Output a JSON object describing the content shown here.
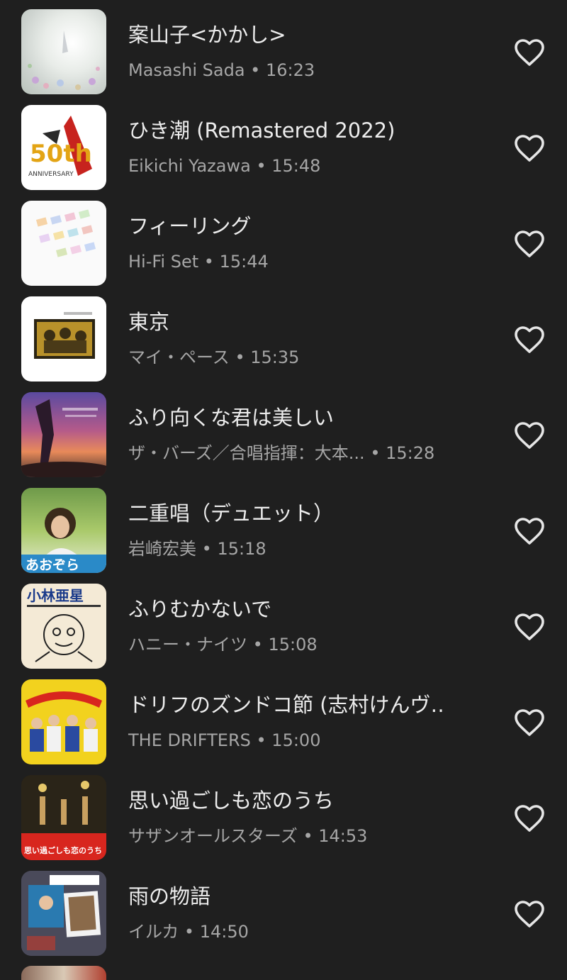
{
  "tracks": [
    {
      "title": "案山子<かかし>",
      "artist": "Masashi Sada",
      "duration": "16:23",
      "art_icon": "album-art-flowers",
      "art_text": ""
    },
    {
      "title": "ひき潮 (Remastered 2022)",
      "artist": "Eikichi Yazawa",
      "duration": "15:48",
      "art_icon": "album-art-50th-anniversary",
      "art_text": "50th"
    },
    {
      "title": "フィーリング",
      "artist": "Hi-Fi Set",
      "duration": "15:44",
      "art_icon": "album-art-pastel",
      "art_text": ""
    },
    {
      "title": "東京",
      "artist": "マイ・ペース",
      "duration": "15:35",
      "art_icon": "album-art-band-photo",
      "art_text": ""
    },
    {
      "title": "ふり向くな君は美しい",
      "artist": "ザ・バーズ／合唱指揮：大本...",
      "duration": "15:28",
      "art_icon": "album-art-sunset",
      "art_text": ""
    },
    {
      "title": "二重唱（デュエット）",
      "artist": "岩崎宏美",
      "duration": "15:18",
      "art_icon": "album-art-portrait",
      "art_text": "あおぞら"
    },
    {
      "title": "ふりむかないで",
      "artist": "ハニー・ナイツ",
      "duration": "15:08",
      "art_icon": "album-art-caricature",
      "art_text": "小林亜星"
    },
    {
      "title": "ドリフのズンドコ節 (志村けんヴ‥",
      "artist": "THE DRIFTERS",
      "duration": "15:00",
      "art_icon": "album-art-drifters",
      "art_text": ""
    },
    {
      "title": "思い過ごしも恋のうち",
      "artist": "サザンオールスターズ",
      "duration": "14:53",
      "art_icon": "album-art-concert",
      "art_text": "思い過ごしも恋のうち"
    },
    {
      "title": "雨の物語",
      "artist": "イルカ",
      "duration": "14:50",
      "art_icon": "album-art-collage",
      "art_text": ""
    }
  ],
  "separator": "•",
  "icons": {
    "favorite": "heart-outline-icon"
  },
  "colors": {
    "background": "#1f1f1f",
    "title": "#ededed",
    "meta": "#a6a6a6",
    "icon": "#e6e6e6"
  }
}
